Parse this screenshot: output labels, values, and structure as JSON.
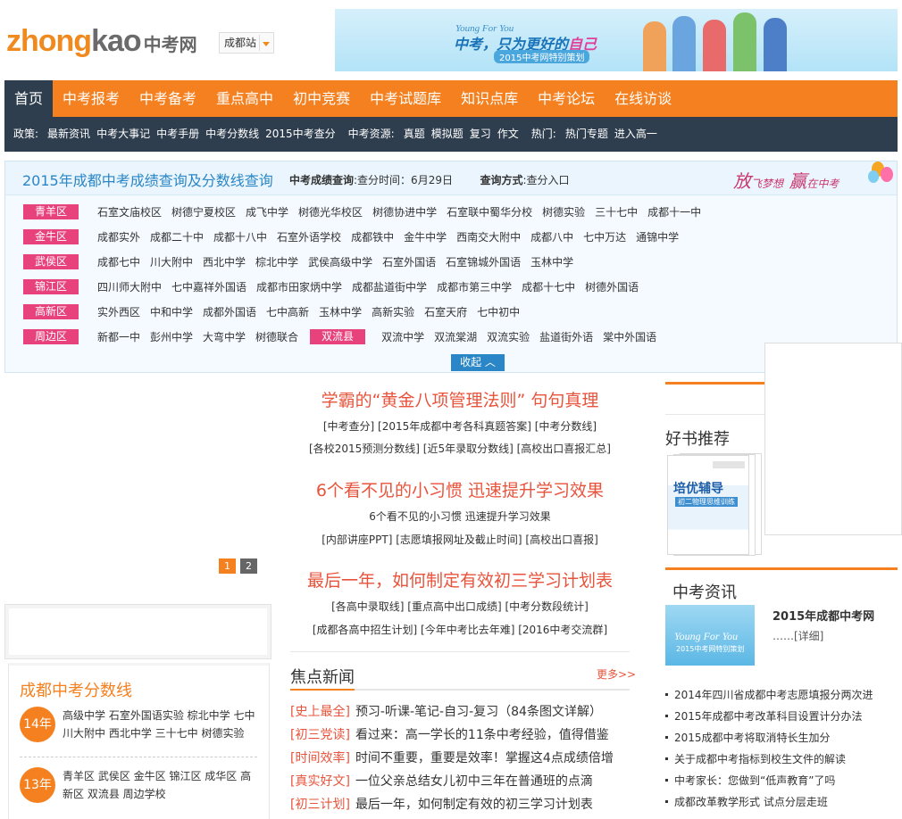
{
  "header": {
    "logo_en1": "zhong",
    "logo_en2": "kao",
    "logo_cn": "中考网",
    "city": "成都站",
    "banner_en": "Young For You",
    "banner_slogan_a": "中考，只为更好的",
    "banner_slogan_b": "自己",
    "banner_plan": "2015中考网特别策划"
  },
  "nav": {
    "items": [
      "首页",
      "中考报考",
      "中考备考",
      "重点高中",
      "初中竞赛",
      "中考试题库",
      "知识点库",
      "中考论坛",
      "在线访谈"
    ]
  },
  "subnav": {
    "policy_label": "政策:",
    "policy": [
      "最新资讯",
      "中考大事记",
      "中考手册",
      "中考分数线",
      "2015中考查分"
    ],
    "resource_label": "中考资源:",
    "resource": [
      "真题",
      "模拟题",
      "复习",
      "作文"
    ],
    "hot_label": "热门:",
    "hot": [
      "热门专题",
      "进入高一"
    ]
  },
  "panel": {
    "title": "2015年成都中考成绩查询及分数线查询",
    "query_label": "中考成绩查询",
    "query_value": ":查分时间：6月29日",
    "method_label": "查询方式",
    "method_value": ":查分入口",
    "motto_a": "放",
    "motto_b": "飞梦想",
    "motto_c": "赢",
    "motto_d": "在中考",
    "collapse": "收起",
    "rows": [
      {
        "district": "青羊区",
        "schools": [
          "石室文庙校区",
          "树德宁夏校区",
          "成飞中学",
          "树德光华校区",
          "树德协进中学",
          "石室联中蜀华分校",
          "树德实验",
          "三十七中",
          "成都十一中"
        ]
      },
      {
        "district": "金牛区",
        "schools": [
          "成都实外",
          "成都二十中",
          "成都十八中",
          "石室外语学校",
          "成都铁中",
          "金牛中学",
          "西南交大附中",
          "成都八中",
          "七中万达",
          "通锦中学"
        ]
      },
      {
        "district": "武侯区",
        "schools": [
          "成都七中",
          "川大附中",
          "西北中学",
          "棕北中学",
          "武侯高级中学",
          "石室外国语",
          "石室锦城外国语",
          "玉林中学"
        ]
      },
      {
        "district": "锦江区",
        "schools": [
          "四川师大附中",
          "七中嘉祥外国语",
          "成都市田家炳中学",
          "成都盐道街中学",
          "成都市第三中学",
          "成都十七中",
          "树德外国语"
        ]
      },
      {
        "district": "高新区",
        "schools": [
          "实外西区",
          "中和中学",
          "成都外国语",
          "七中高新",
          "玉林中学",
          "高新实验",
          "石室天府",
          "七中初中"
        ]
      },
      {
        "district": "周边区",
        "schools": [
          "新都一中",
          "彭州中学",
          "大弯中学",
          "树德联合"
        ],
        "extra_district": "双流县",
        "extra_schools": [
          "双流中学",
          "双流棠湖",
          "双流实验",
          "盐道街外语",
          "棠中外国语"
        ]
      }
    ]
  },
  "pager": [
    "1",
    "2"
  ],
  "scores": {
    "title": "成都中考分数线",
    "items": [
      {
        "year": "14年",
        "text": "高级中学 石室外国语实验 棕北中学 七中 川大附中 西北中学 三十七中 树德实验"
      },
      {
        "year": "13年",
        "text": "青羊区 武侯区 金牛区 锦江区 成华区 高新区 双流县 周边学校"
      }
    ]
  },
  "middle": {
    "blocks": [
      {
        "title": "学霸的“黄金八项管理法则” 句句真理",
        "lines": [
          "[中考查分] [2015年成都中考各科真题答案] [中考分数线]",
          "[各校2015预测分数线] [近5年录取分数线] [高校出口喜报汇总]"
        ]
      },
      {
        "title": "6个看不见的小习惯 迅速提升学习效果",
        "lines": [
          "6个看不见的小习惯 迅速提升学习效果",
          "[内部讲座PPT] [志愿填报网址及截止时间] [高校出口喜报]"
        ]
      },
      {
        "title": "最后一年，如何制定有效初三学习计划表",
        "lines": [
          "[各高中录取线] [重点高中出口成绩] [中考分数段统计]",
          "[成都各高中招生计划] [今年中考比去年难] [2016中考交流群]"
        ]
      }
    ],
    "focus_title": "焦点新闻",
    "focus_more": "更多>>",
    "news": [
      {
        "tag": "[史上最全]",
        "text": "预习-听课-笔记-自习-复习（84条图文详解）"
      },
      {
        "tag": "[初三党读]",
        "text": "看过来：高一学长的11条中考经验，值得借鉴"
      },
      {
        "tag": "[时间效率]",
        "text": "时间不重要，重要是效率！掌握这4点成绩倍增"
      },
      {
        "tag": "[真实好文]",
        "text": "一位父亲总结女儿初中三年在普通班的点滴"
      },
      {
        "tag": "[初三计划]",
        "text": "最后一年，如何制定有效的初三学习计划表"
      }
    ]
  },
  "right": {
    "books_title": "好书推荐",
    "book_title": "培优辅导",
    "book_sub": "初二物理思维训练",
    "news_title": "中考资讯",
    "img_en": "Young For You",
    "img_cn": "2015中考网特别策划",
    "news_head": "2015年成都中考网",
    "news_desc": "……[详细]",
    "list": [
      "2014年四川省成都中考志愿填报分两次进",
      "2015年成都中考改革科目设置计分办法",
      "2015成都中考将取消特长生加分",
      "关于成都中考指标到校生文件的解读",
      "中考家长：您做到“低声教育”了吗",
      "成都改革教学形式 试点分层走班"
    ]
  }
}
